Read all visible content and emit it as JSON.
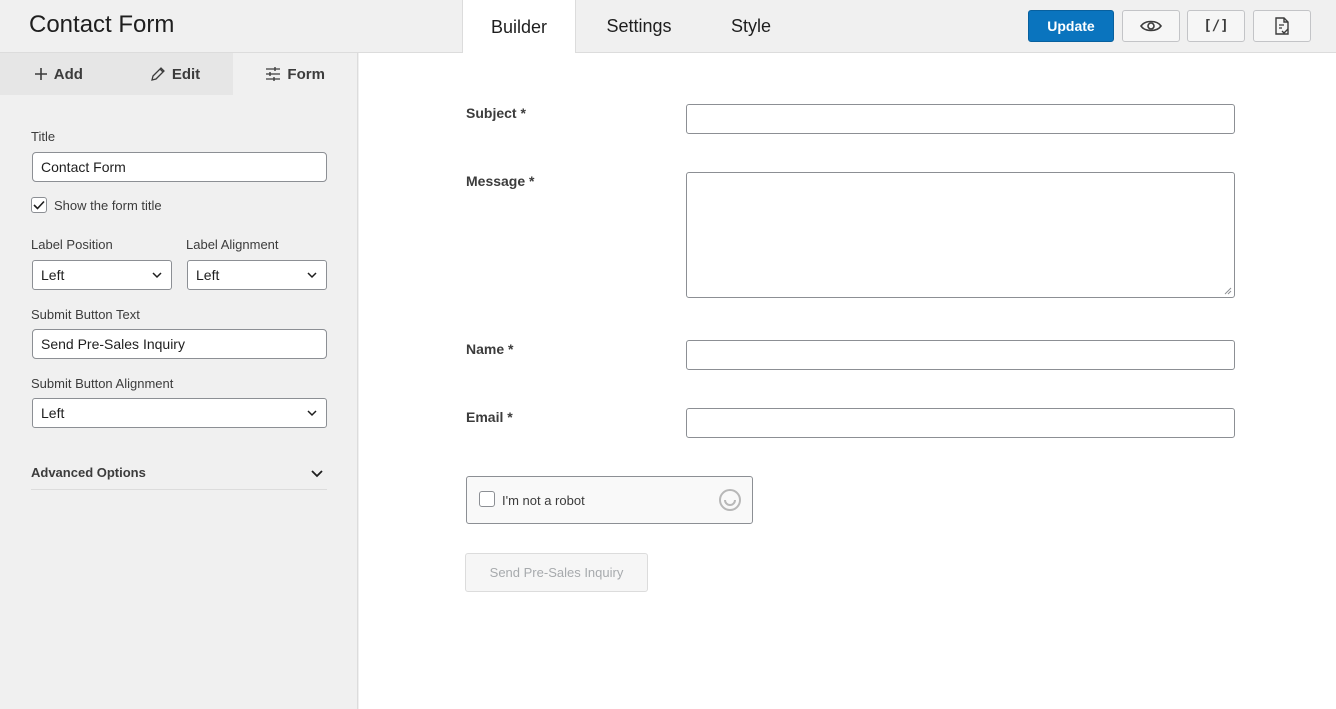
{
  "app": {
    "title": "Contact Form"
  },
  "tabs": [
    {
      "label": "Builder",
      "active": true
    },
    {
      "label": "Settings",
      "active": false
    },
    {
      "label": "Style",
      "active": false
    }
  ],
  "toolbar": {
    "update_label": "Update",
    "preview_icon": "eye-icon",
    "shortcode_label": "[/]",
    "export_icon": "document-check-icon",
    "accent_color": "#0a74be"
  },
  "sidebar": {
    "tabs": [
      {
        "label": "Add",
        "icon": "plus-icon"
      },
      {
        "label": "Edit",
        "icon": "pencil-icon"
      },
      {
        "label": "Form",
        "icon": "sliders-icon",
        "active": true
      }
    ],
    "title_label": "Title",
    "title_value": "Contact Form",
    "show_title_label": "Show the form title",
    "show_title_checked": true,
    "label_position_label": "Label Position",
    "label_position_value": "Left",
    "label_alignment_label": "Label Alignment",
    "label_alignment_value": "Left",
    "submit_text_label": "Submit Button Text",
    "submit_text_value": "Send Pre-Sales Inquiry",
    "submit_alignment_label": "Submit Button Alignment",
    "submit_alignment_value": "Left",
    "advanced_label": "Advanced Options"
  },
  "form": {
    "fields": [
      {
        "label": "Subject *",
        "type": "text"
      },
      {
        "label": "Message *",
        "type": "textarea"
      },
      {
        "label": "Name *",
        "type": "text"
      },
      {
        "label": "Email *",
        "type": "text"
      }
    ],
    "captcha_label": "I'm not a robot",
    "submit_label": "Send Pre-Sales Inquiry"
  }
}
